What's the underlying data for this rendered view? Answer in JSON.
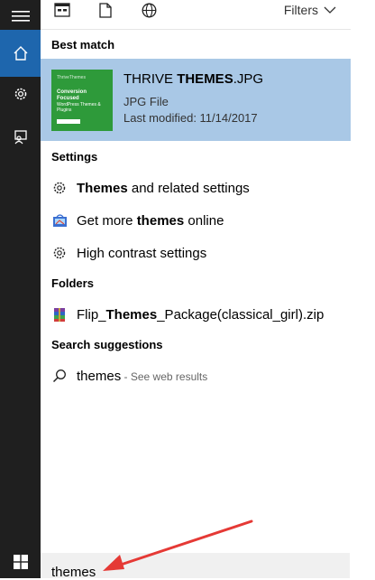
{
  "topbar": {
    "filters_label": "Filters"
  },
  "sections": {
    "best_match": "Best match",
    "settings": "Settings",
    "folders": "Folders",
    "search_suggestions": "Search suggestions"
  },
  "best_match_item": {
    "title_prefix": "THRIVE ",
    "title_bold": "THEMES",
    "title_suffix": ".JPG",
    "type": "JPG File",
    "modified": "Last modified: 11/14/2017",
    "thumb_brand": "ThriveThemes",
    "thumb_heading": "Conversion Focused",
    "thumb_sub": "WordPress Themes & Plugins"
  },
  "settings_items": [
    {
      "bold": "Themes",
      "rest": " and related settings",
      "icon": "gear-icon"
    },
    {
      "prefix": "Get more ",
      "bold": "themes",
      "rest": " online",
      "icon": "store-icon"
    },
    {
      "text": "High contrast settings",
      "icon": "gear-icon"
    }
  ],
  "folder_item": {
    "prefix": "Flip_",
    "bold": "Themes",
    "rest": "_Package(classical_girl).zip",
    "icon": "winrar-archive-icon"
  },
  "suggestion": {
    "text": "themes",
    "hint": " - See web results"
  },
  "search": {
    "query": "themes"
  },
  "colors": {
    "rail": "#1f1f1f",
    "rail_active": "#1e66ad",
    "selection": "#a9c8e6",
    "arrow": "#e53935"
  }
}
